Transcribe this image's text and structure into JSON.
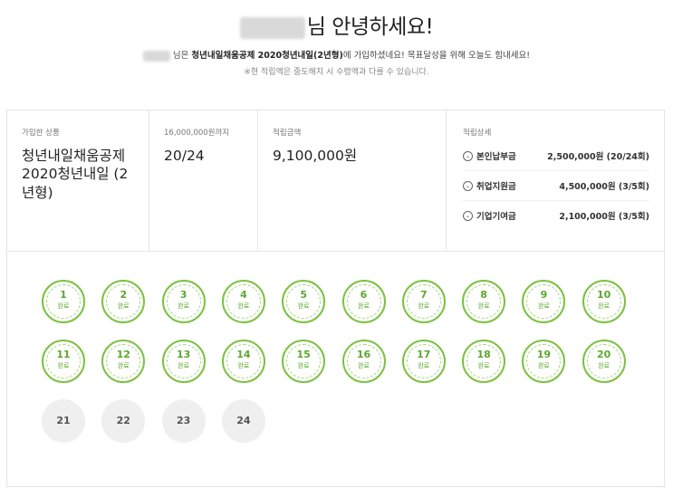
{
  "greeting": {
    "suffix": "님 안녕하세요!",
    "sub_prefix": "님은 ",
    "sub_product": "청년내일채움공제 2020청년내일(2년형)",
    "sub_suffix": "에 가입하셨네요! 목표달성을 위해 오늘도 힘내세요!",
    "note": "※현 적립액은 중도해지 시 수령액과 다를 수 있습니다."
  },
  "summary": {
    "product_label": "가입한 상품",
    "product_name": "청년내일채움공제 2020청년내일 (2년형)",
    "goal_label": "16,000,000원까지",
    "progress": "20/24",
    "balance_label": "적립금액",
    "balance": "9,100,000원",
    "detail_label": "적립상세",
    "details": [
      {
        "name": "본인납부금",
        "amount": "2,500,000원 (20/24회)"
      },
      {
        "name": "취업지원금",
        "amount": "4,500,000원 (3/5회)"
      },
      {
        "name": "기업기여금",
        "amount": "2,100,000원 (3/5회)"
      }
    ]
  },
  "installments": {
    "done_label": "완료",
    "items": [
      {
        "n": "1",
        "done": true
      },
      {
        "n": "2",
        "done": true
      },
      {
        "n": "3",
        "done": true
      },
      {
        "n": "4",
        "done": true
      },
      {
        "n": "5",
        "done": true
      },
      {
        "n": "6",
        "done": true
      },
      {
        "n": "7",
        "done": true
      },
      {
        "n": "8",
        "done": true
      },
      {
        "n": "9",
        "done": true
      },
      {
        "n": "10",
        "done": true
      },
      {
        "n": "11",
        "done": true
      },
      {
        "n": "12",
        "done": true
      },
      {
        "n": "13",
        "done": true
      },
      {
        "n": "14",
        "done": true
      },
      {
        "n": "15",
        "done": true
      },
      {
        "n": "16",
        "done": true
      },
      {
        "n": "17",
        "done": true
      },
      {
        "n": "18",
        "done": true
      },
      {
        "n": "19",
        "done": true
      },
      {
        "n": "20",
        "done": true
      },
      {
        "n": "21",
        "done": false
      },
      {
        "n": "22",
        "done": false
      },
      {
        "n": "23",
        "done": false
      },
      {
        "n": "24",
        "done": false
      }
    ]
  },
  "colors": {
    "accent": "#7cc142",
    "pending": "#efefef"
  }
}
